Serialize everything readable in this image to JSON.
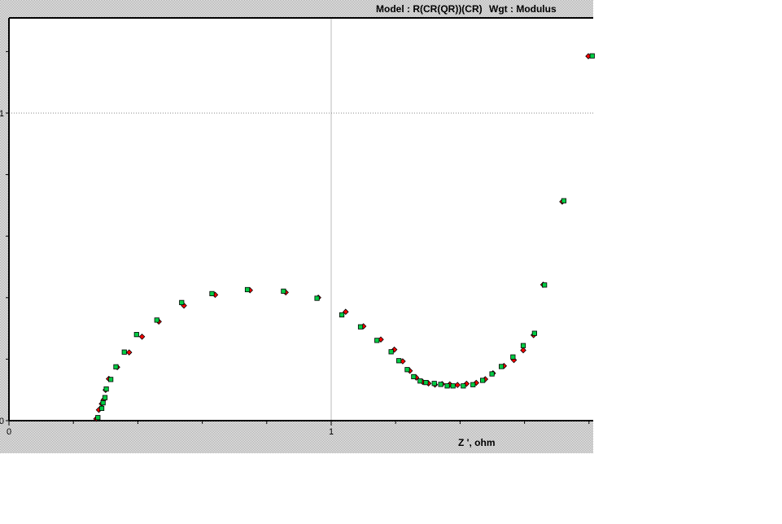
{
  "header": {
    "model_label": "Model : R(CR(QR))(CR)",
    "weight_label": "Wgt : Modulus"
  },
  "colors": {
    "panel_background": "#d4d4d4",
    "plot_background": "#ffffff",
    "measured_marker": "#ff0000",
    "fitted_marker": "#00cc44",
    "gridline": "#bbbbbb"
  },
  "chart_data": {
    "type": "scatter",
    "title": "",
    "xlabel": "Z ',  ohm",
    "ylabel": "",
    "xlim": [
      0,
      1.81
    ],
    "ylim": [
      0,
      1.31
    ],
    "x_tick_labels": [
      {
        "value": 0,
        "label": "0"
      },
      {
        "value": 1,
        "label": "1"
      }
    ],
    "y_tick_labels": [
      {
        "value": 0,
        "label": "0"
      },
      {
        "value": 1,
        "label": "1"
      }
    ],
    "grid": "major lines at x=1 and y=1",
    "series": [
      {
        "marker": "diamond",
        "color": "#ff0000",
        "x": [
          0.271,
          0.279,
          0.288,
          0.294,
          0.3,
          0.31,
          0.336,
          0.373,
          0.413,
          0.465,
          0.543,
          0.64,
          0.748,
          0.859,
          0.96,
          1.045,
          1.1,
          1.154,
          1.196,
          1.222,
          1.244,
          1.264,
          1.284,
          1.302,
          1.322,
          1.344,
          1.368,
          1.392,
          1.42,
          1.45,
          1.478,
          1.502,
          1.536,
          1.567,
          1.596,
          1.628,
          1.658,
          1.717,
          1.798
        ],
        "y": [
          0.006,
          0.035,
          0.055,
          0.068,
          0.1,
          0.136,
          0.174,
          0.222,
          0.273,
          0.322,
          0.374,
          0.409,
          0.424,
          0.417,
          0.4,
          0.354,
          0.307,
          0.264,
          0.231,
          0.193,
          0.162,
          0.14,
          0.126,
          0.121,
          0.117,
          0.119,
          0.118,
          0.116,
          0.12,
          0.123,
          0.135,
          0.154,
          0.178,
          0.197,
          0.229,
          0.278,
          0.442,
          0.712,
          1.185
        ]
      },
      {
        "marker": "square",
        "color": "#00cc44",
        "x": [
          0.276,
          0.288,
          0.292,
          0.298,
          0.302,
          0.316,
          0.332,
          0.358,
          0.396,
          0.459,
          0.536,
          0.63,
          0.74,
          0.852,
          0.956,
          1.033,
          1.091,
          1.142,
          1.186,
          1.21,
          1.236,
          1.256,
          1.276,
          1.294,
          1.32,
          1.34,
          1.36,
          1.378,
          1.41,
          1.44,
          1.47,
          1.499,
          1.528,
          1.564,
          1.596,
          1.631,
          1.662,
          1.722,
          1.81
        ],
        "y": [
          0.01,
          0.04,
          0.058,
          0.075,
          0.103,
          0.134,
          0.175,
          0.223,
          0.28,
          0.327,
          0.384,
          0.413,
          0.426,
          0.421,
          0.398,
          0.344,
          0.305,
          0.261,
          0.224,
          0.195,
          0.166,
          0.143,
          0.129,
          0.124,
          0.121,
          0.118,
          0.113,
          0.113,
          0.113,
          0.117,
          0.131,
          0.152,
          0.176,
          0.207,
          0.244,
          0.284,
          0.441,
          0.715,
          1.186
        ]
      }
    ]
  }
}
